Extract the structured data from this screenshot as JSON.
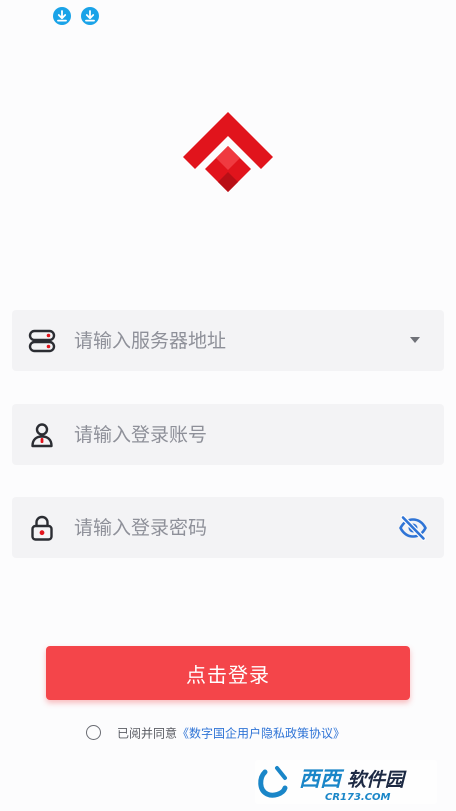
{
  "status_bar": {
    "icons": [
      "download-icon",
      "download-icon"
    ]
  },
  "colors": {
    "brand_red": "#e1141c",
    "login_button": "#f4454a",
    "field_background": "#f3f3f5",
    "placeholder": "#8e9099",
    "eye_icon": "#2f74d6",
    "status_icon": "#1aa3e8",
    "link": "#2f74d6"
  },
  "logo": {
    "icon": "diamond-logo-icon"
  },
  "form": {
    "server": {
      "placeholder": "请输入服务器地址",
      "value": "",
      "icon": "server-icon",
      "dropdown_icon": "caret-down-icon"
    },
    "account": {
      "placeholder": "请输入登录账号",
      "value": "",
      "icon": "user-icon"
    },
    "password": {
      "placeholder": "请输入登录密码",
      "value": "",
      "icon": "lock-icon",
      "toggle_icon": "eye-off-icon"
    }
  },
  "login_button": {
    "label": "点击登录"
  },
  "agreement": {
    "checked": false,
    "prefix": "已阅并同意",
    "link": "《数字国企用户隐私政策协议》"
  },
  "watermark": {
    "text_cn": "西西软件园",
    "text_en": "CR173.COM"
  }
}
